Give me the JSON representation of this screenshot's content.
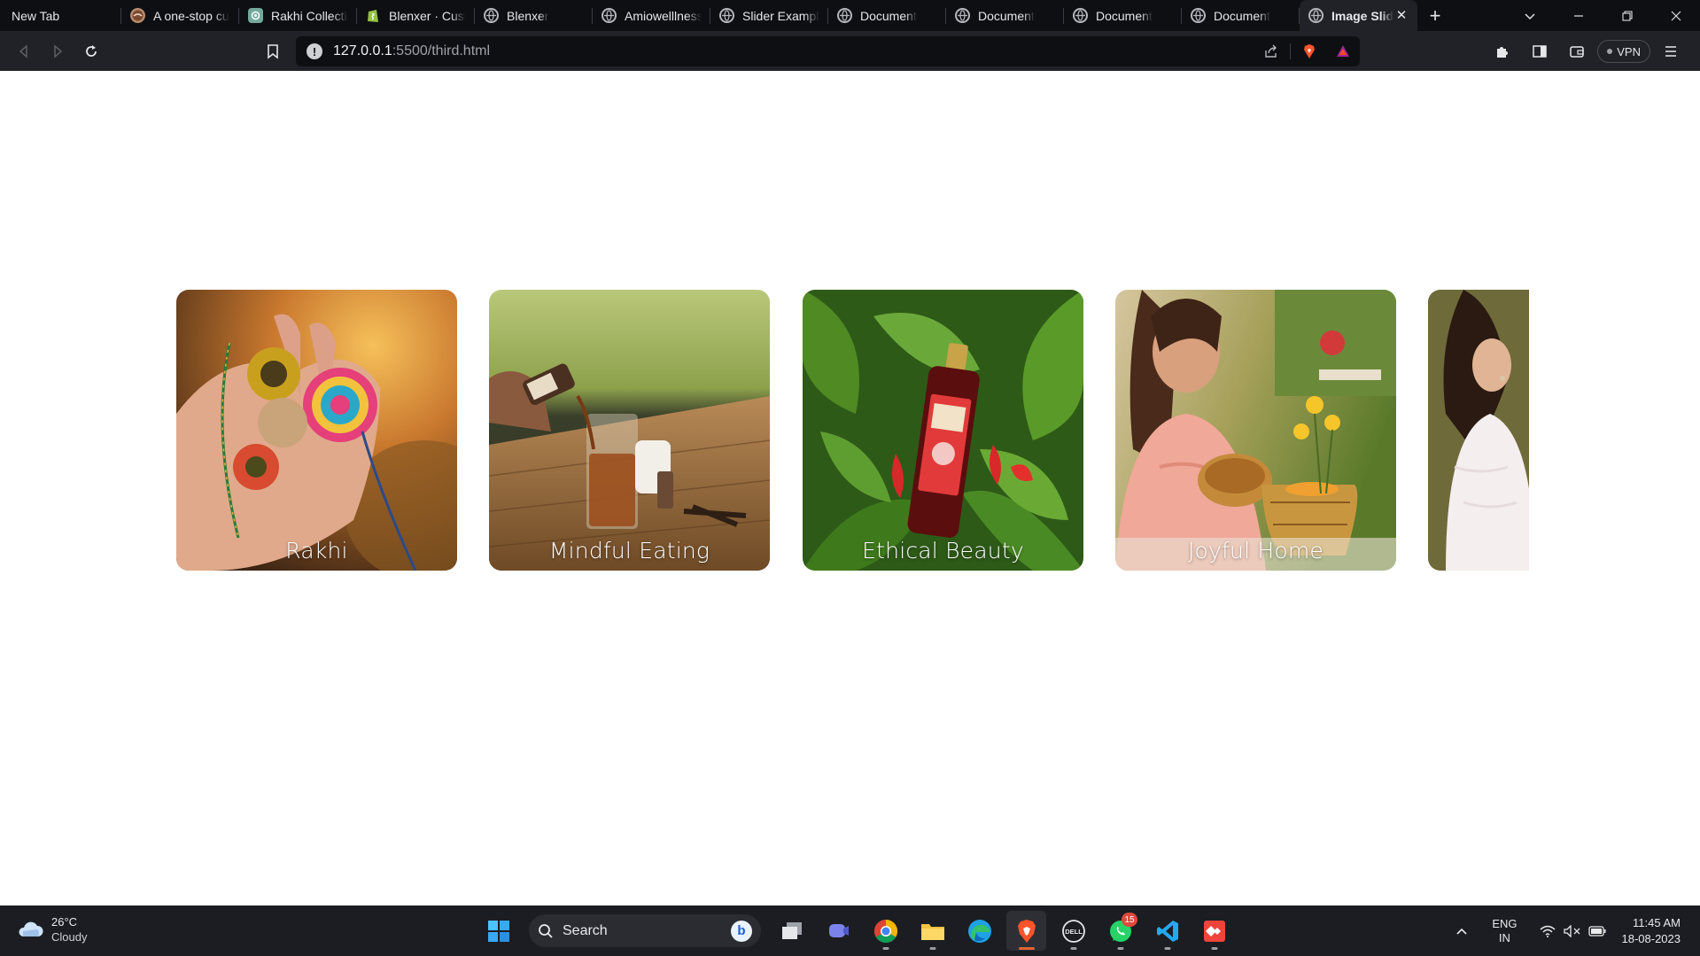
{
  "browser": {
    "tabs": [
      {
        "title": "New Tab",
        "icon": "none"
      },
      {
        "title": "A one-stop cu",
        "icon": "site-logo-icon"
      },
      {
        "title": "Rakhi Collectio",
        "icon": "openai-icon"
      },
      {
        "title": "Blenxer · Cust",
        "icon": "shopify-icon"
      },
      {
        "title": "Blenxer",
        "icon": "globe-icon"
      },
      {
        "title": "Amiowelllness",
        "icon": "globe-icon"
      },
      {
        "title": "Slider Example",
        "icon": "globe-icon"
      },
      {
        "title": "Document",
        "icon": "globe-icon"
      },
      {
        "title": "Document",
        "icon": "globe-icon"
      },
      {
        "title": "Document",
        "icon": "globe-icon"
      },
      {
        "title": "Document",
        "icon": "globe-icon"
      },
      {
        "title": "Image Slid",
        "icon": "globe-icon",
        "active": true
      }
    ],
    "new_tab_label": "+",
    "url_host": "127.0.0.1",
    "url_path": ":5500/third.html",
    "vpn_label": "VPN"
  },
  "slider": {
    "cards": [
      {
        "caption": "Rakhi"
      },
      {
        "caption": "Mindful Eating"
      },
      {
        "caption": "Ethical Beauty"
      },
      {
        "caption": "Joyful Home"
      },
      {
        "caption": ""
      }
    ]
  },
  "taskbar": {
    "weather_temp": "26°C",
    "weather_condition": "Cloudy",
    "search_label": "Search",
    "whatsapp_badge": "15",
    "lang_line1": "ENG",
    "lang_line2": "IN",
    "time": "11:45 AM",
    "date": "18-08-2023"
  },
  "colors": {
    "tabstrip_bg": "#0d0f13",
    "toolbar_bg": "#202227",
    "taskbar_bg": "#1c1d22",
    "page_bg": "#ffffff",
    "active_indicator": "#e06436"
  }
}
